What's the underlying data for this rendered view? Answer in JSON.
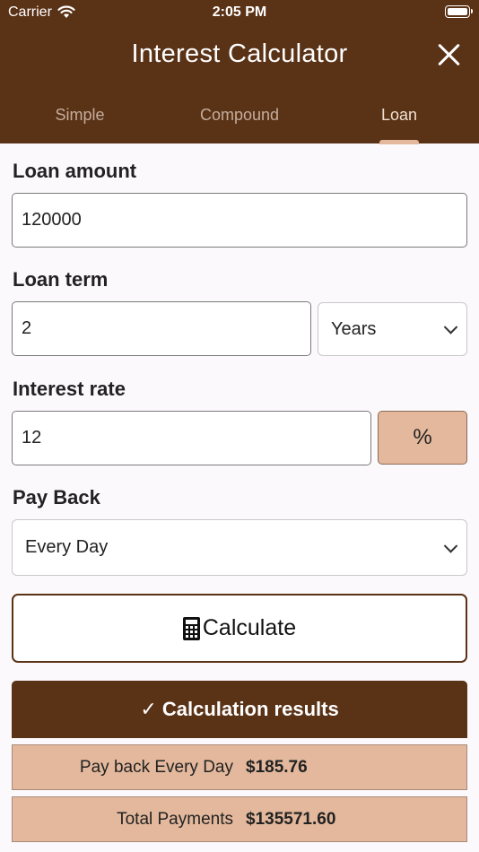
{
  "status_bar": {
    "carrier": "Carrier",
    "time": "2:05 PM"
  },
  "header": {
    "title": "Interest Calculator"
  },
  "tabs": [
    {
      "label": "Simple",
      "active": false
    },
    {
      "label": "Compound",
      "active": false
    },
    {
      "label": "Loan",
      "active": true
    }
  ],
  "form": {
    "loan_amount": {
      "label": "Loan amount",
      "value": "120000"
    },
    "loan_term": {
      "label": "Loan term",
      "value": "2",
      "unit": "Years"
    },
    "interest_rate": {
      "label": "Interest rate",
      "value": "12",
      "unit_button": "%"
    },
    "pay_back": {
      "label": "Pay Back",
      "value": "Every Day"
    }
  },
  "calculate_label": "Calculate",
  "results": {
    "header": "✓ Calculation results",
    "rows": [
      {
        "label": "Pay back Every Day",
        "value": "$185.76"
      },
      {
        "label": "Total Payments",
        "value": "$135571.60"
      }
    ]
  },
  "colors": {
    "brand": "#5a3216",
    "accent": "#e3b89c",
    "background": "#fcf9fc"
  }
}
